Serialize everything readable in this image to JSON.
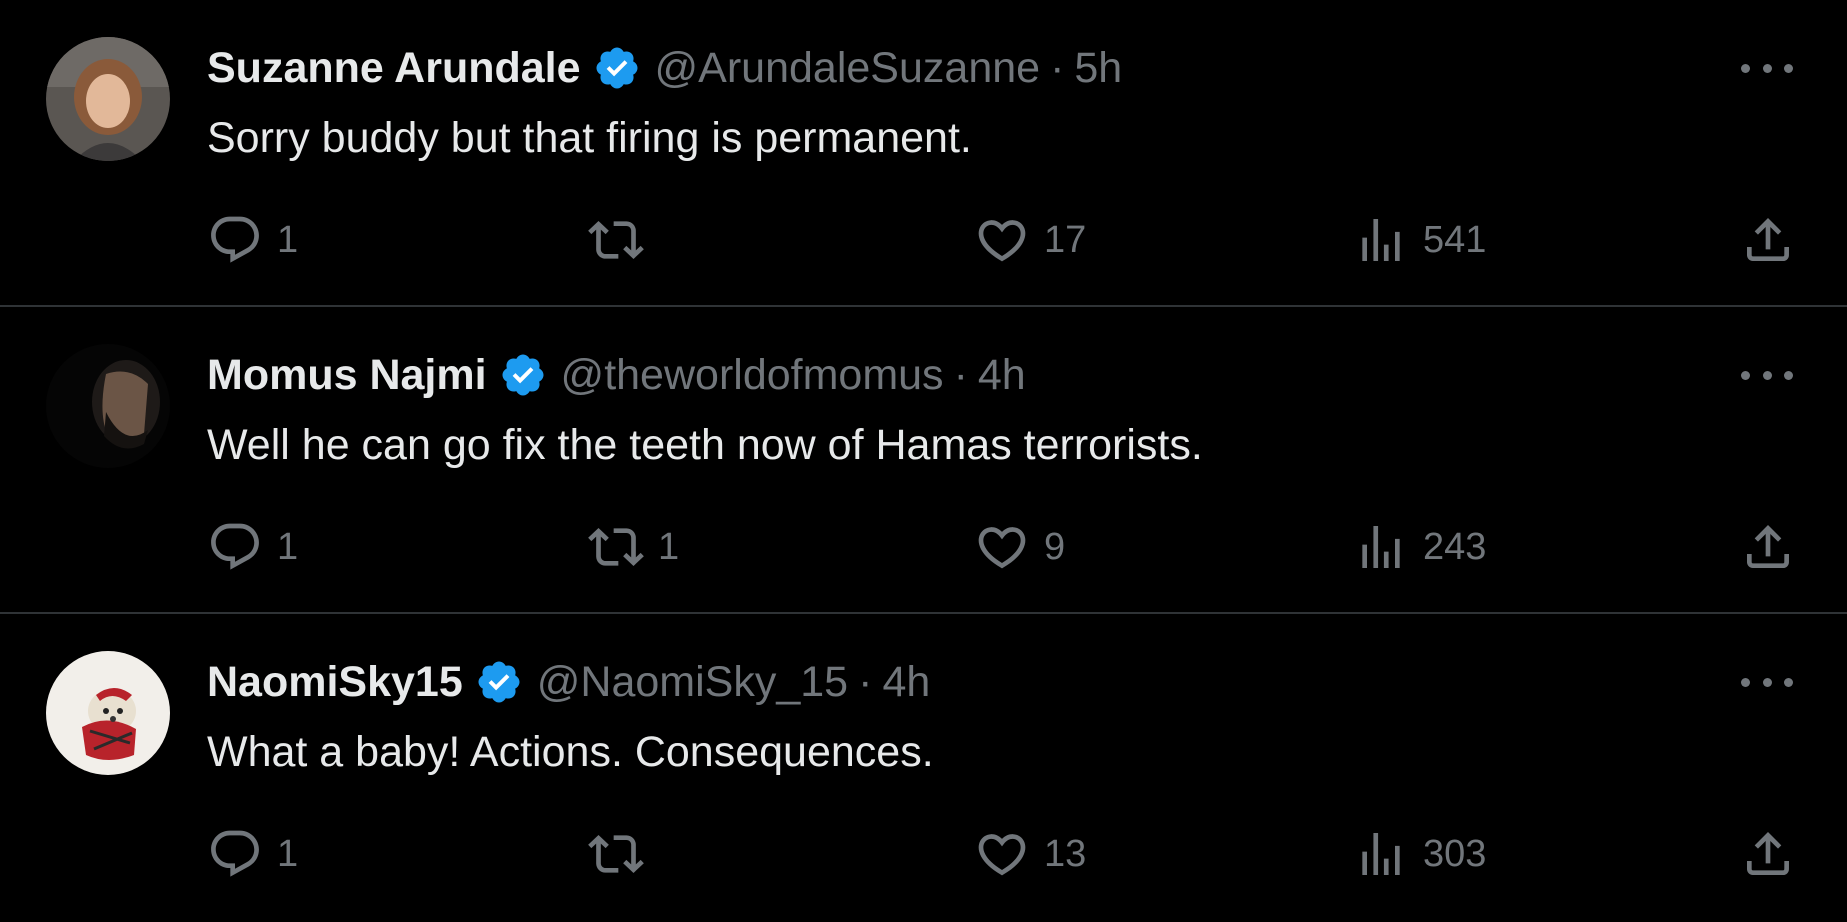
{
  "tweets": [
    {
      "display_name": "Suzanne Arundale",
      "handle": "@ArundaleSuzanne",
      "separator": "·",
      "time": "5h",
      "text": "Sorry buddy but that firing is permanent.",
      "verified_icon": "verified-badge-icon",
      "avatar_icon": "avatar-photo",
      "replies": "1",
      "retweets": "",
      "likes": "17",
      "views": "541"
    },
    {
      "display_name": "Momus Najmi",
      "handle": "@theworldofmomus",
      "separator": "·",
      "time": "4h",
      "text": "Well he can go fix the teeth now of Hamas terrorists.",
      "verified_icon": "verified-badge-icon",
      "avatar_icon": "avatar-photo",
      "replies": "1",
      "retweets": "1",
      "likes": "9",
      "views": "243"
    },
    {
      "display_name": "NaomiSky15",
      "handle": "@NaomiSky_15",
      "separator": "·",
      "time": "4h",
      "text": "What a baby! Actions. Consequences.",
      "verified_icon": "verified-badge-icon",
      "avatar_icon": "avatar-photo",
      "replies": "1",
      "retweets": "",
      "likes": "13",
      "views": "303"
    }
  ],
  "icons": {
    "reply": "reply-icon",
    "retweet": "retweet-icon",
    "like": "heart-icon",
    "views": "views-chart-icon",
    "share": "share-icon",
    "more": "more-options-icon"
  },
  "colors": {
    "background": "#000000",
    "primary_text": "#e7e9ea",
    "secondary_text": "#71767b",
    "verified_blue": "#1d9bf0",
    "divider": "#2f3336"
  }
}
